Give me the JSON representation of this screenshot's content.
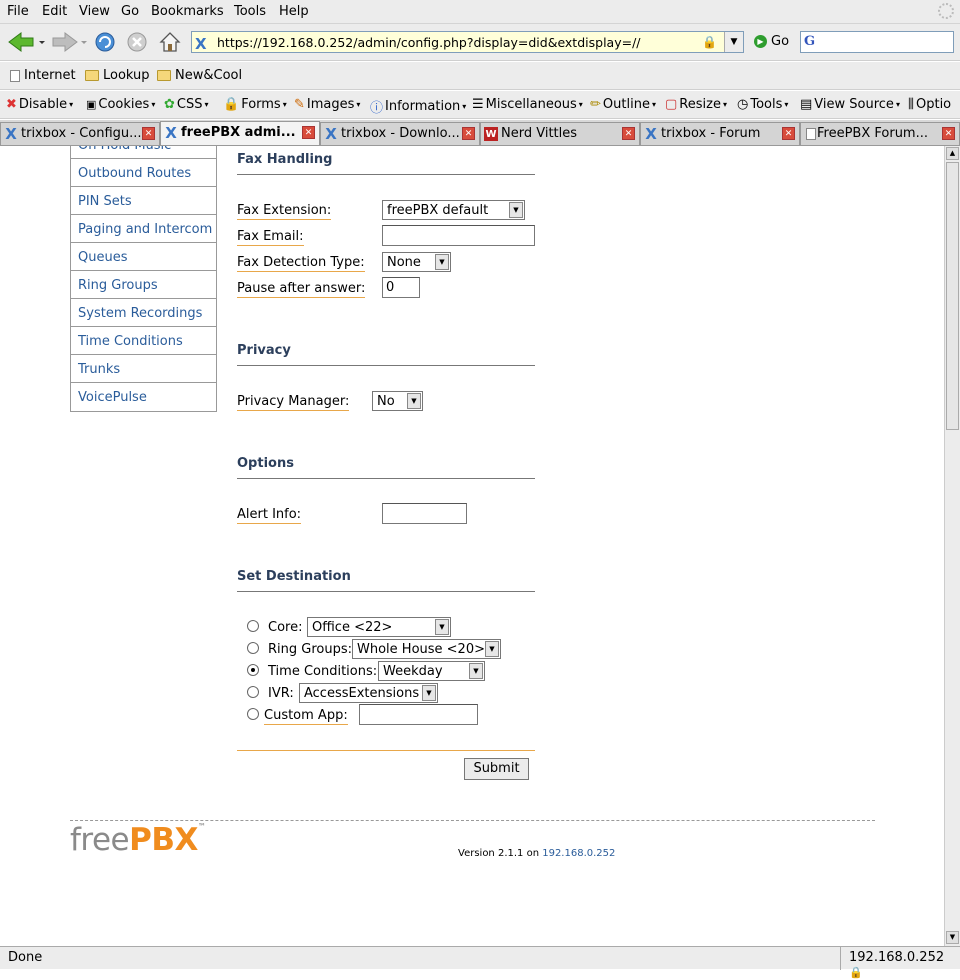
{
  "menubar": {
    "items": [
      {
        "label": "File"
      },
      {
        "label": "Edit"
      },
      {
        "label": "View"
      },
      {
        "label": "Go"
      },
      {
        "label": "Bookmarks"
      },
      {
        "label": "Tools"
      },
      {
        "label": "Help"
      }
    ]
  },
  "navbar": {
    "url": "https://192.168.0.252/admin/config.php?display=did&extdisplay=//",
    "go_label": "Go"
  },
  "bookmarks": {
    "items": [
      {
        "label": "Internet",
        "icon": "page-icon"
      },
      {
        "label": "Lookup",
        "icon": "folder-icon"
      },
      {
        "label": "New&Cool",
        "icon": "folder-icon"
      }
    ]
  },
  "devbar": {
    "items": [
      {
        "label": "Disable"
      },
      {
        "label": "Cookies"
      },
      {
        "label": "CSS"
      },
      {
        "label": "Forms"
      },
      {
        "label": "Images"
      },
      {
        "label": "Information"
      },
      {
        "label": "Miscellaneous"
      },
      {
        "label": "Outline"
      },
      {
        "label": "Resize"
      },
      {
        "label": "Tools"
      },
      {
        "label": "View Source"
      },
      {
        "label": "Optio"
      }
    ]
  },
  "tabs": [
    {
      "label": "trixbox - Configu...",
      "active": false
    },
    {
      "label": "freePBX admi...",
      "active": true
    },
    {
      "label": "trixbox - Downlo...",
      "active": false
    },
    {
      "label": "Nerd Vittles",
      "active": false
    },
    {
      "label": "trixbox - Forum",
      "active": false
    },
    {
      "label": "FreePBX Forum...",
      "active": false
    }
  ],
  "leftnav": {
    "items": [
      {
        "label": "On Hold Music"
      },
      {
        "label": "Outbound Routes"
      },
      {
        "label": "PIN Sets"
      },
      {
        "label": "Paging and Intercom"
      },
      {
        "label": "Queues"
      },
      {
        "label": "Ring Groups"
      },
      {
        "label": "System Recordings"
      },
      {
        "label": "Time Conditions"
      },
      {
        "label": "Trunks"
      },
      {
        "label": "VoicePulse"
      }
    ]
  },
  "form": {
    "fax": {
      "heading": "Fax Handling",
      "ext_label": "Fax Extension:",
      "ext_value": "freePBX default",
      "email_label": "Fax Email:",
      "email_value": "",
      "detect_label": "Fax Detection Type:",
      "detect_value": "None",
      "pause_label": "Pause after answer:",
      "pause_value": "0"
    },
    "privacy": {
      "heading": "Privacy",
      "manager_label": "Privacy Manager:",
      "manager_value": "No"
    },
    "options": {
      "heading": "Options",
      "alert_label": "Alert Info:",
      "alert_value": ""
    },
    "destination": {
      "heading": "Set Destination",
      "core_label": "Core:",
      "core_value": "Office <22>",
      "ring_label": "Ring Groups:",
      "ring_value": "Whole House <20>",
      "time_label": "Time Conditions:",
      "time_value": "Weekday",
      "ivr_label": "IVR:",
      "ivr_value": "AccessExtensions",
      "custom_label": "Custom App:",
      "custom_value": "",
      "selected": "Time Conditions"
    },
    "submit_label": "Submit"
  },
  "footer": {
    "logo_free": "free",
    "logo_pbx": "PBX",
    "logo_tm": "™",
    "version_text": "Version 2.1.1 on",
    "version_ip": "192.168.0.252"
  },
  "status": {
    "text": "Done",
    "ip": "192.168.0.252"
  }
}
